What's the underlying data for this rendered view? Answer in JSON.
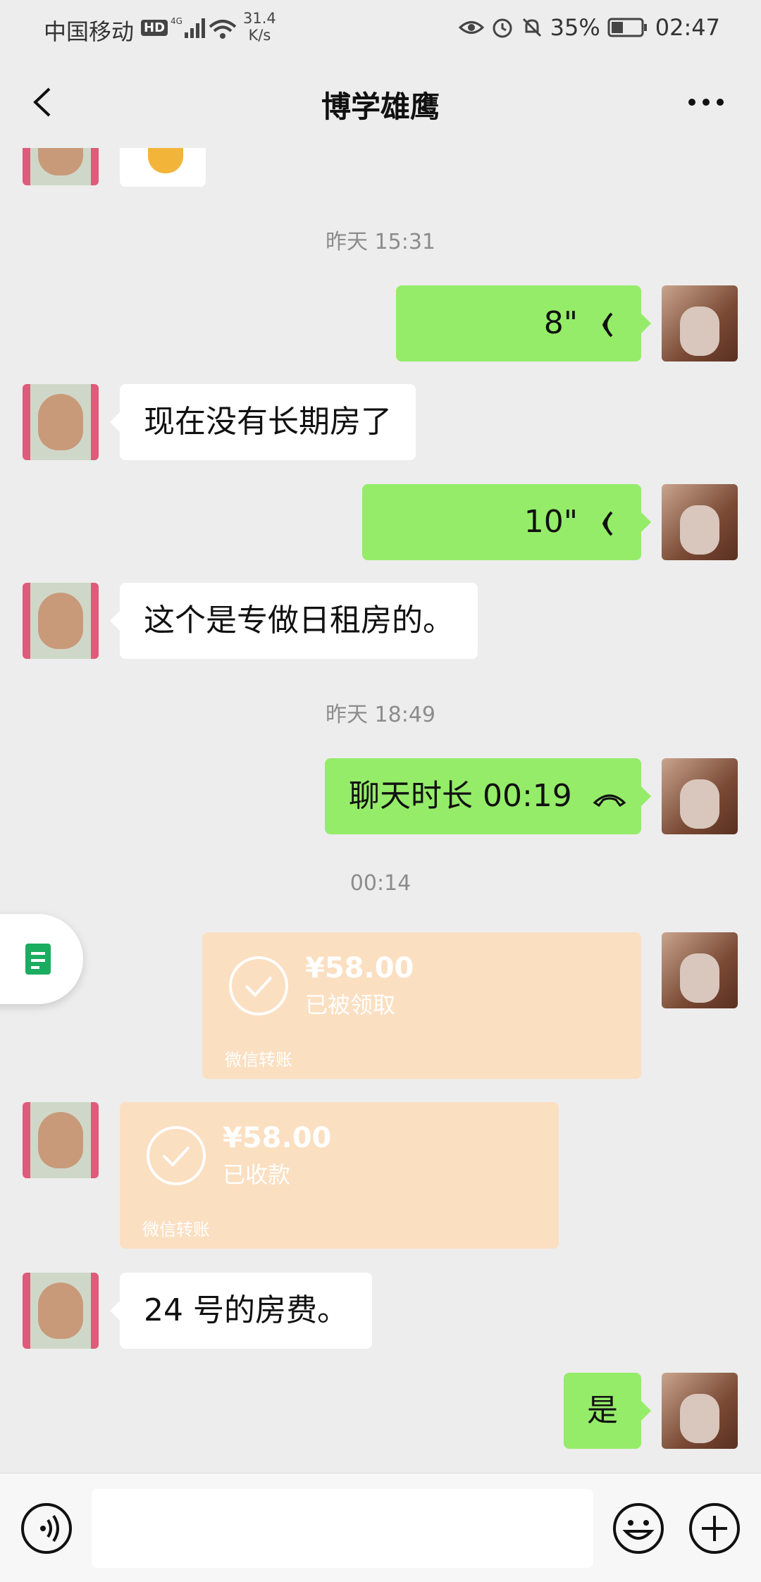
{
  "status_bar": {
    "carrier": "中国移动",
    "hd": "HD",
    "net_speed": "31.4",
    "net_unit": "K/s",
    "battery": "35%",
    "time": "02:47"
  },
  "header": {
    "title": "博学雄鹰"
  },
  "messages": {
    "t1": "昨天 15:31",
    "voice1": "8\"",
    "m1": "现在没有长期房了",
    "voice2": "10\"",
    "m2": "这个是专做日租房的。",
    "t2": "昨天 18:49",
    "call": "聊天时长 00:19",
    "t3": "00:14",
    "transfer1": {
      "amount": "¥58.00",
      "status": "已被领取",
      "footer": "微信转账"
    },
    "transfer2": {
      "amount": "¥58.00",
      "status": "已收款",
      "footer": "微信转账"
    },
    "m3": "24 号的房费。",
    "reply": "是"
  },
  "icons": [
    "back-icon",
    "more-icon",
    "voice-wave-icon",
    "phone-hangup-icon",
    "check-icon",
    "document-icon",
    "voice-input-icon",
    "emoji-icon",
    "plus-icon"
  ],
  "colors": {
    "green": "#95ec69",
    "card": "#fbdfc1",
    "bg": "#ededed"
  }
}
